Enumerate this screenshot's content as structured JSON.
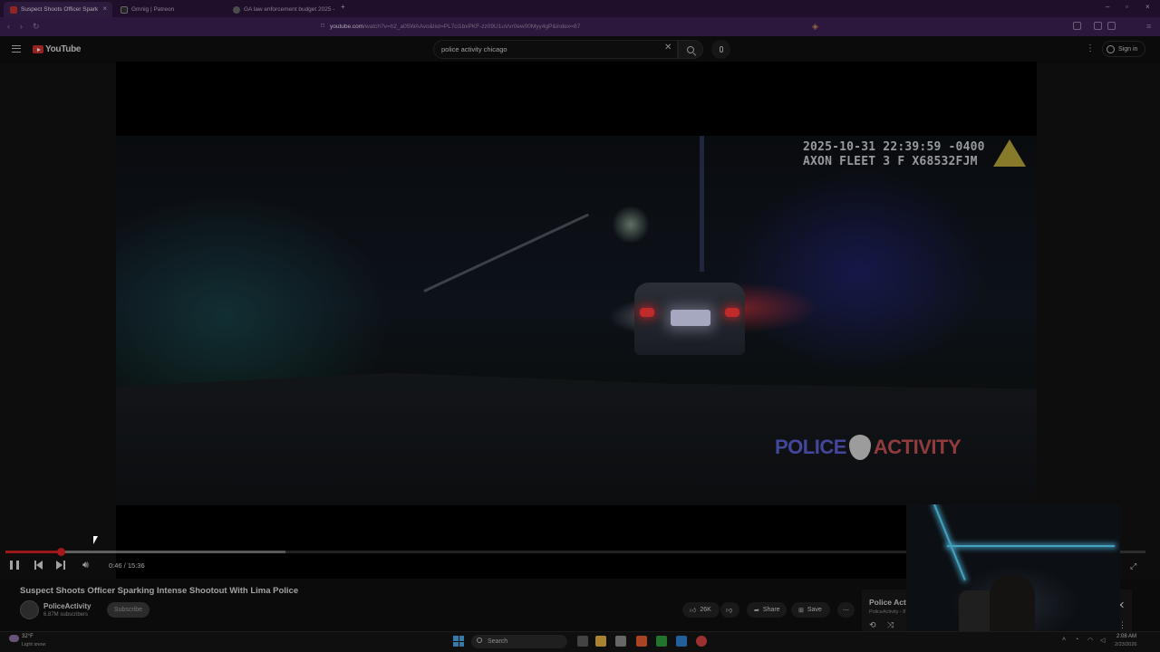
{
  "browser": {
    "tabs": [
      {
        "label": "Suspect Shoots Officer Spark",
        "active": true
      },
      {
        "label": "Gmnig | Patreon",
        "active": false
      },
      {
        "label": "GA law enforcement budget 2025 -",
        "active": false
      }
    ],
    "new_tab": "+",
    "url_host": "youtube.com",
    "url_path": "/watch?v=h2_a05WAAvo&list=PL7ci1bxPKF-zz09U1uVvr0ew00Myy4gP&index=87"
  },
  "youtube": {
    "logo_text": "YouTube",
    "search_query": "police activity chicago",
    "signin_label": "Sign in"
  },
  "video": {
    "overlay_timestamp": "2025-10-31 22:39:59 -0400",
    "overlay_device": "AXON FLEET 3 F X68532FJM",
    "watermark_left": "POLICE",
    "watermark_right": "ACTIVITY",
    "progress_fraction": 0.049,
    "buffer_fraction": 0.246,
    "time_display": "0:46 / 15:36",
    "title": "Suspect Shoots Officer Sparking Intense Shootout With Lima Police"
  },
  "channel": {
    "name": "PoliceActivity",
    "subscribers": "6.87M subscribers",
    "subscribe_label": "Subscribe"
  },
  "actions": {
    "likes": "26K",
    "share_label": "Share",
    "save_label": "Save"
  },
  "mini_player": {
    "title": "Police Activity",
    "subtitle": "PoliceActivity - 87 / 2..."
  },
  "taskbar": {
    "weather_temp": "32°F",
    "weather_desc": "Light snow",
    "search_placeholder": "Search",
    "clock_time": "2:08 AM",
    "clock_date": "2/23/2026"
  },
  "colors": {
    "progress_played": "#d02020",
    "tab_strip": "#2a1538",
    "address_bar": "#3a2050"
  }
}
